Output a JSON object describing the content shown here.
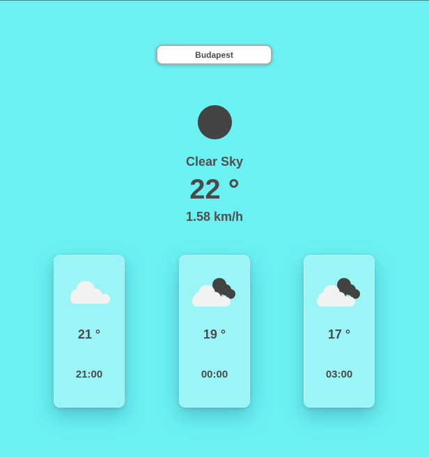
{
  "search": {
    "value": "Budapest"
  },
  "current": {
    "icon": "clear-sky-icon",
    "condition": "Clear Sky",
    "temperature": "22 °",
    "wind": "1.58 km/h"
  },
  "forecast": [
    {
      "icon": "cloud-icon",
      "temperature": "21 °",
      "time": "21:00"
    },
    {
      "icon": "broken-clouds-icon",
      "temperature": "19 °",
      "time": "00:00"
    },
    {
      "icon": "broken-clouds-icon",
      "temperature": "17 °",
      "time": "03:00"
    }
  ],
  "colors": {
    "background": "#6cf1f2",
    "card": "#9bf4f6",
    "text": "#4a4a4a",
    "dark_icon": "#434343",
    "cloud": "#f2f2f2"
  }
}
